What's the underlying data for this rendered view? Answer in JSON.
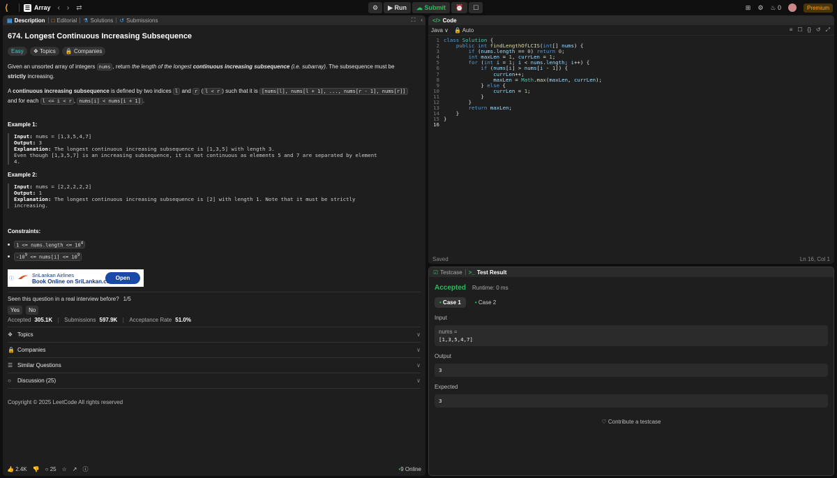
{
  "topbar": {
    "list_name": "Array",
    "run_label": "Run",
    "submit_label": "Submit",
    "streak_count": "0",
    "premium_label": "Premium"
  },
  "left_tabs": {
    "description": "Description",
    "editorial": "Editorial",
    "solutions": "Solutions",
    "submissions": "Submissions"
  },
  "problem": {
    "title": "674. Longest Continuous Increasing Subsequence",
    "difficulty": "Easy",
    "topics_chip": "Topics",
    "companies_chip": "Companies",
    "p1_a": "Given an unsorted array of integers ",
    "p1_code": "nums",
    "p1_b": ", return ",
    "p1_c": "the length of the longest ",
    "p1_d": "continuous increasing subsequence",
    "p1_e": " (i.e. subarray)",
    "p1_f": ". The subsequence must be ",
    "p1_g": "strictly",
    "p1_h": " increasing.",
    "p2_a": "A ",
    "p2_b": "continuous increasing subsequence",
    "p2_c": " is defined by two indices ",
    "p2_l": "l",
    "p2_d": " and ",
    "p2_r": "r",
    "p2_e": " (",
    "p2_lr": "l < r",
    "p2_f": ") such that it is ",
    "p2_seq": "[nums[l], nums[l + 1], ..., nums[r - 1], nums[r]]",
    "p2_g": " and for each ",
    "p2_cond": "l <= i < r",
    "p2_h": ", ",
    "p2_cmp": "nums[i] < nums[i + 1]",
    "p2_i": ".",
    "example1_title": "Example 1:",
    "example1_input_label": "Input:",
    "example1_input": " nums = [1,3,5,4,7]",
    "example1_output_label": "Output:",
    "example1_output": " 3",
    "example1_expl_label": "Explanation:",
    "example1_expl": " The longest continuous increasing subsequence is [1,3,5] with length 3.",
    "example1_expl2": "Even though [1,3,5,7] is an increasing subsequence, it is not continuous as elements 5 and 7 are separated by element",
    "example1_expl3": "4.",
    "example2_title": "Example 2:",
    "example2_input_label": "Input:",
    "example2_input": " nums = [2,2,2,2,2]",
    "example2_output_label": "Output:",
    "example2_output": " 1",
    "example2_expl_label": "Explanation:",
    "example2_expl": " The longest continuous increasing subsequence is [2] with length 1. Note that it must be strictly",
    "example2_expl2": "increasing.",
    "constraints_title": "Constraints:",
    "c1_a": "1 <= nums.length <= 10",
    "c1_sup": "4",
    "c2_a": "-10",
    "c2_sup1": "9",
    "c2_b": " <= nums[i] <= 10",
    "c2_sup2": "9"
  },
  "ad": {
    "brand": "SriLankan Airlines",
    "line": "Book Online on SriLankan.com",
    "cta": "Open"
  },
  "interview": {
    "question": "Seen this question in a real interview before?",
    "count": "1/5",
    "yes": "Yes",
    "no": "No"
  },
  "stats": {
    "accepted_label": "Accepted",
    "accepted": "305.1K",
    "submissions_label": "Submissions",
    "submissions": "597.9K",
    "rate_label": "Acceptance Rate",
    "rate": "51.0%"
  },
  "sections": {
    "topics": "Topics",
    "companies": "Companies",
    "similar": "Similar Questions",
    "discussion": "Discussion (25)"
  },
  "footer": {
    "copyright": "Copyright © 2025 LeetCode All rights reserved"
  },
  "bottom": {
    "likes": "2.4K",
    "comments": "25",
    "online": "9 Online"
  },
  "code": {
    "tab": "Code",
    "language": "Java",
    "mode": "Auto",
    "status": "Saved",
    "cursor": "Ln 16, Col 1"
  },
  "result": {
    "testcase_tab": "Testcase",
    "result_tab": "Test Result",
    "status": "Accepted",
    "runtime": "Runtime: 0 ms",
    "case1": "Case 1",
    "case2": "Case 2",
    "input_label": "Input",
    "input_name": "nums =",
    "input_value": "[1,3,5,4,7]",
    "output_label": "Output",
    "output_value": "3",
    "expected_label": "Expected",
    "expected_value": "3",
    "contribute": "Contribute a testcase"
  }
}
